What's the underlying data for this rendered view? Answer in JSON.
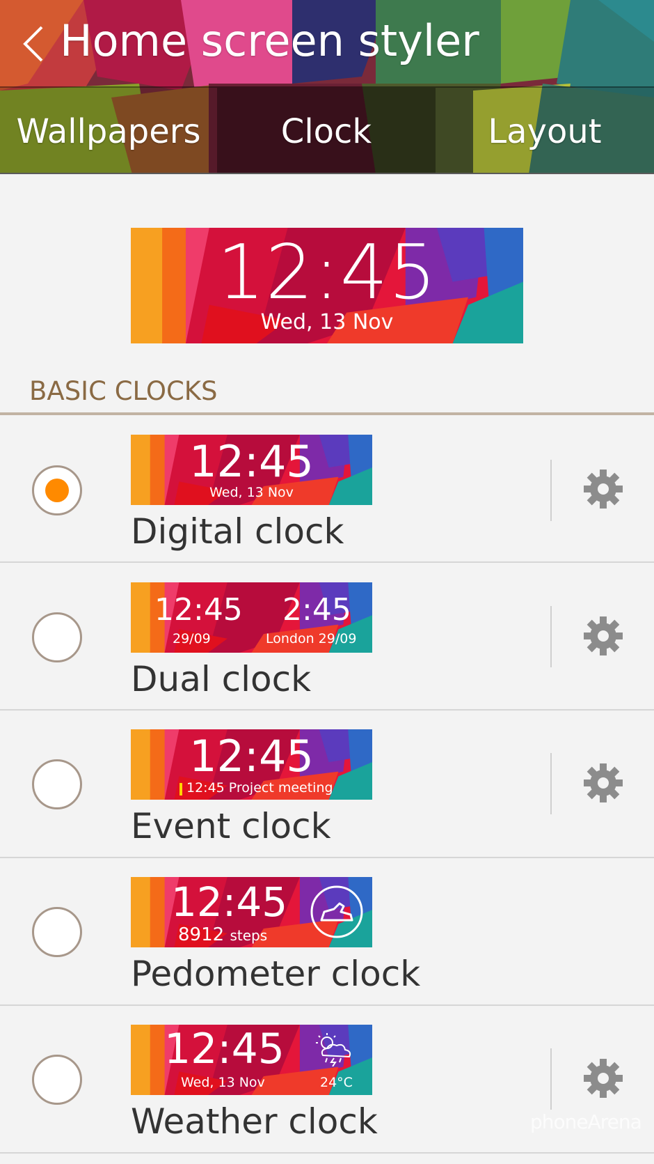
{
  "header": {
    "title": "Home screen styler",
    "tabs": [
      {
        "label": "Wallpapers",
        "selected": false
      },
      {
        "label": "Clock",
        "selected": true
      },
      {
        "label": "Layout",
        "selected": false
      }
    ]
  },
  "preview": {
    "time": "12:45",
    "date": "Wed, 13 Nov"
  },
  "section": {
    "title": "BASIC CLOCKS"
  },
  "clocks": [
    {
      "label": "Digital clock",
      "selected": true,
      "time": "12:45",
      "sub": "Wed, 13 Nov",
      "has_settings": true
    },
    {
      "label": "Dual clock",
      "selected": false,
      "time": "12:45",
      "sub": "29/09",
      "time2": "2:45",
      "sub2": "London 29/09",
      "has_settings": true
    },
    {
      "label": "Event clock",
      "selected": false,
      "time": "12:45",
      "sub": "12:45 Project meeting",
      "has_settings": true
    },
    {
      "label": "Pedometer clock",
      "selected": false,
      "time": "12:45",
      "sub_value": "8912",
      "sub_unit": "steps",
      "icon": "sneaker-icon",
      "has_settings": false
    },
    {
      "label": "Weather clock",
      "selected": false,
      "time": "12:45",
      "sub": "Wed, 13 Nov",
      "temp": "24°C",
      "icon": "storm-cloud-icon",
      "has_settings": true
    }
  ],
  "watermark": "phoneArena",
  "colors": {
    "accent_radio": "#ff8a00",
    "section_title": "#8a6a44",
    "background": "#f3f3f3"
  }
}
